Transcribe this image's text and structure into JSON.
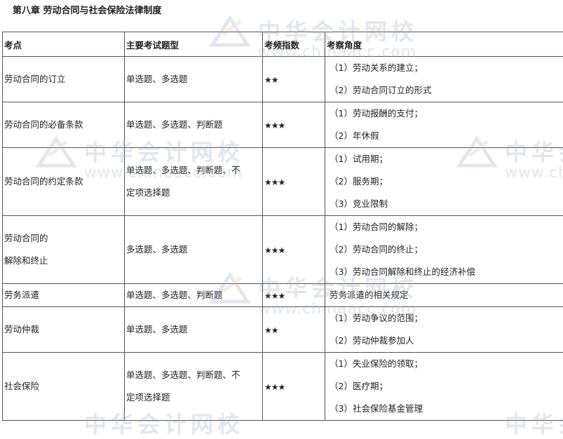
{
  "title": "第八章 劳动合同与社会保险法律制度",
  "headers": [
    "考点",
    "主要考试题型",
    "考频指数",
    "考察角度"
  ],
  "rows": [
    {
      "topic": [
        "劳动合同的订立"
      ],
      "types": [
        "单选题、多选题"
      ],
      "stars": "★★",
      "aspects": [
        "（1）劳动关系的建立；",
        "（2）劳动合同订立的形式"
      ]
    },
    {
      "topic": [
        "劳动合同的必备条款"
      ],
      "types": [
        "单选题、多选题、判断题"
      ],
      "stars": "★★★",
      "aspects": [
        "（1）劳动报酬的支付；",
        "（2）年休假"
      ]
    },
    {
      "topic": [
        "劳动合同的约定条款"
      ],
      "types": [
        "单选题、多选题、判断题、不",
        "定项选择题"
      ],
      "stars": "★★★",
      "aspects": [
        "（1）试用期；",
        "（2）服务期；",
        "（3）竞业限制"
      ]
    },
    {
      "topic": [
        "劳动合同的",
        "解除和终止"
      ],
      "types": [
        "多选题、多选题"
      ],
      "stars": "★★★",
      "aspects": [
        "（1）劳动合同的解除；",
        "（2）劳动合同的终止；",
        "（3）劳动合同解除和终止的经济补偿"
      ]
    },
    {
      "topic": [
        "劳务派遣"
      ],
      "types": [
        "单选题、多选题、判断题"
      ],
      "stars": "★★★",
      "aspects": [
        "劳务派遣的相关规定"
      ]
    },
    {
      "topic": [
        "劳动仲裁"
      ],
      "types": [
        "单选题、多选题"
      ],
      "stars": "★★",
      "aspects": [
        "（1）劳动争议的范围；",
        "（2）劳动仲裁参加人"
      ]
    },
    {
      "topic": [
        "社会保险"
      ],
      "types": [
        "单选题、多选题、判断题、不",
        "定项选择题"
      ],
      "stars": "★★★",
      "aspects": [
        "（1）失业保险的领取；",
        "（2）医疗期；",
        "（3）社会保险基金管理"
      ]
    }
  ],
  "watermark": {
    "cn": "中华会计网校",
    "en": "www.chinaacc.com"
  }
}
